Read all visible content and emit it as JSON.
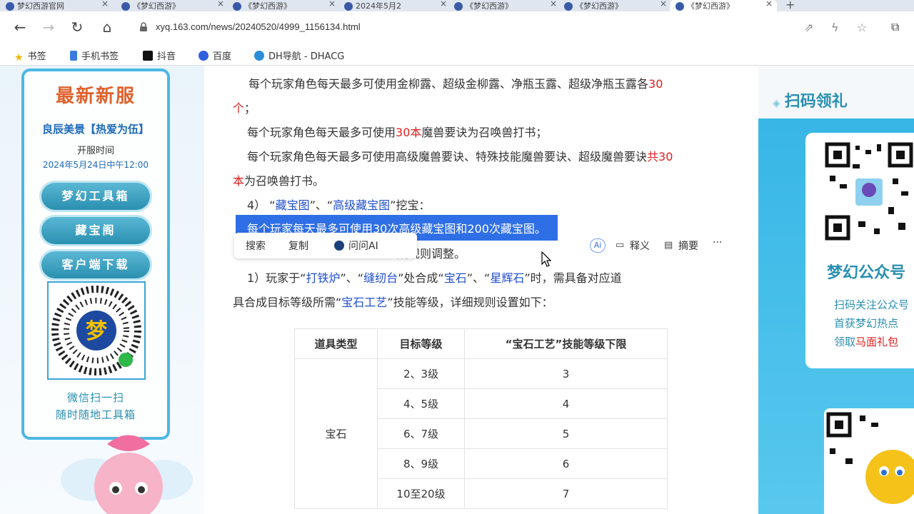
{
  "tabs": [
    {
      "title": "梦幻西游官网"
    },
    {
      "title": "《梦幻西游》"
    },
    {
      "title": "《梦幻西游》"
    },
    {
      "title": "2024年5月2"
    },
    {
      "title": "《梦幻西游》"
    },
    {
      "title": "《梦幻西游》"
    },
    {
      "title": "《梦幻西游》"
    }
  ],
  "toolbar": {
    "back": "←",
    "forward": "→",
    "reload": "↻",
    "home": "⌂",
    "url": "xyq.163.com/news/20240520/4999_1156134.html",
    "new_tab": "+"
  },
  "bookmarks": [
    {
      "label": "书签",
      "icon": "star-icon",
      "color": "#f5b400"
    },
    {
      "label": "手机书签",
      "icon": "phone-icon",
      "color": "#3a7be0"
    },
    {
      "label": "抖音",
      "icon": "douyin-icon",
      "color": "#111111"
    },
    {
      "label": "百度",
      "icon": "baidu-icon",
      "color": "#2f5ee0"
    },
    {
      "label": "DH导航 - DHACG",
      "icon": "cloud-icon",
      "color": "#2a8fd8"
    }
  ],
  "left_sidebar": {
    "title": "最新新服",
    "server_name": "良辰美景【热爱为伍】",
    "open_label": "开服时间",
    "open_time": "2024年5月24日中午12:00",
    "buttons": [
      "梦幻工具箱",
      "藏宝阁",
      "客户端下载"
    ],
    "qr_caption_1": "微信扫一扫",
    "qr_caption_2": "随时随地工具箱"
  },
  "article": {
    "l1a": "每个玩家角色每天最多可使用金柳露、超级金柳露、净瓶玉露、超级净瓶玉露各",
    "l1b": "30",
    "l2a": "个",
    "l2b": "；",
    "l3a": "每个玩家角色每天最多可使用",
    "l3b": "30本",
    "l3c": "魔兽要诀为召唤兽打书；",
    "l4a": "每个玩家角色每天最多可使用高级魔兽要诀、特殊技能魔兽要诀、超级魔兽要诀",
    "l4b": "共30",
    "l5a": "本",
    "l5b": "为召唤兽打书。",
    "l6a": "4） “",
    "l6b": "藏宝图",
    "l6c": "”、“",
    "l6d": "高级藏宝图",
    "l6e": "”挖宝：",
    "l7": "每个玩家每天最多可使用30次高级藏宝图和200次藏宝图。",
    "l8": "成规则调整。",
    "l9a": "1）玩家于“",
    "l9b": "打铁炉",
    "l9c": "”、“",
    "l9d": "缝纫台",
    "l9e": "”处合成“",
    "l9f": "宝石",
    "l9g": "”、“",
    "l9h": "星辉石",
    "l9i": "”时，需具备对应道",
    "l10a": "具合成目标等级所需“",
    "l10b": "宝石工艺",
    "l10c": "”技能等级，详细规则设置如下："
  },
  "context_menu": {
    "search": "搜索",
    "copy": "复制",
    "ask_ai": "问问AI",
    "ai_badge": "Ai",
    "explain": "释义",
    "summary": "摘要",
    "more": "···"
  },
  "table": {
    "headers": [
      "道具类型",
      "目标等级",
      "“宝石工艺”技能等级下限"
    ],
    "item_type": "宝石",
    "rows": [
      {
        "level": "2、3级",
        "min": "3"
      },
      {
        "level": "4、5级",
        "min": "4"
      },
      {
        "level": "6、7级",
        "min": "5"
      },
      {
        "level": "8、9级",
        "min": "6"
      },
      {
        "level": "10至20级",
        "min": "7"
      }
    ]
  },
  "right_sidebar": {
    "title": "扫码领礼",
    "gzh_title": "梦幻公众号",
    "line1": "扫码关注公众号",
    "line2": "首获梦幻热点",
    "line3a": "领取",
    "line3b": "马面礼包"
  }
}
